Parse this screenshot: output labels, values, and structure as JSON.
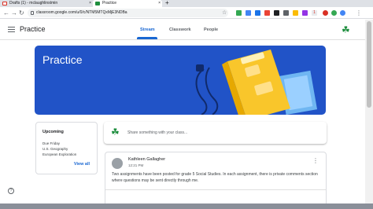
{
  "browser": {
    "tabs": [
      {
        "label": "Drafts (1) - mclaughlinstmin",
        "close": "×"
      },
      {
        "label": "Practice",
        "close": "×"
      }
    ],
    "new_tab": "+",
    "url": "classroom.google.com/u/0/c/NTM5MTQxMjE3NDBa",
    "extension_badge": "1"
  },
  "header": {
    "class_name": "Practice",
    "tabs": [
      "Stream",
      "Classwork",
      "People"
    ],
    "active_tab": "Stream"
  },
  "banner": {
    "title": "Practice",
    "color": "#2153c7"
  },
  "upcoming": {
    "title": "Upcoming",
    "due": "Due Friday",
    "items": [
      "U.S. Geography",
      "European Exploration"
    ],
    "view_all": "View all"
  },
  "share": {
    "placeholder": "Share something with your class..."
  },
  "post": {
    "author": "Kathleen Gallagher",
    "time": "12:21 PM",
    "body": "Two assignments have been posted for grade 5 Social Studies. In each assignment, there is private comments section where questions may be sent directly through me."
  },
  "help": "?",
  "colors": {
    "accent": "#1967d2",
    "clover": "#1e8e3e"
  }
}
